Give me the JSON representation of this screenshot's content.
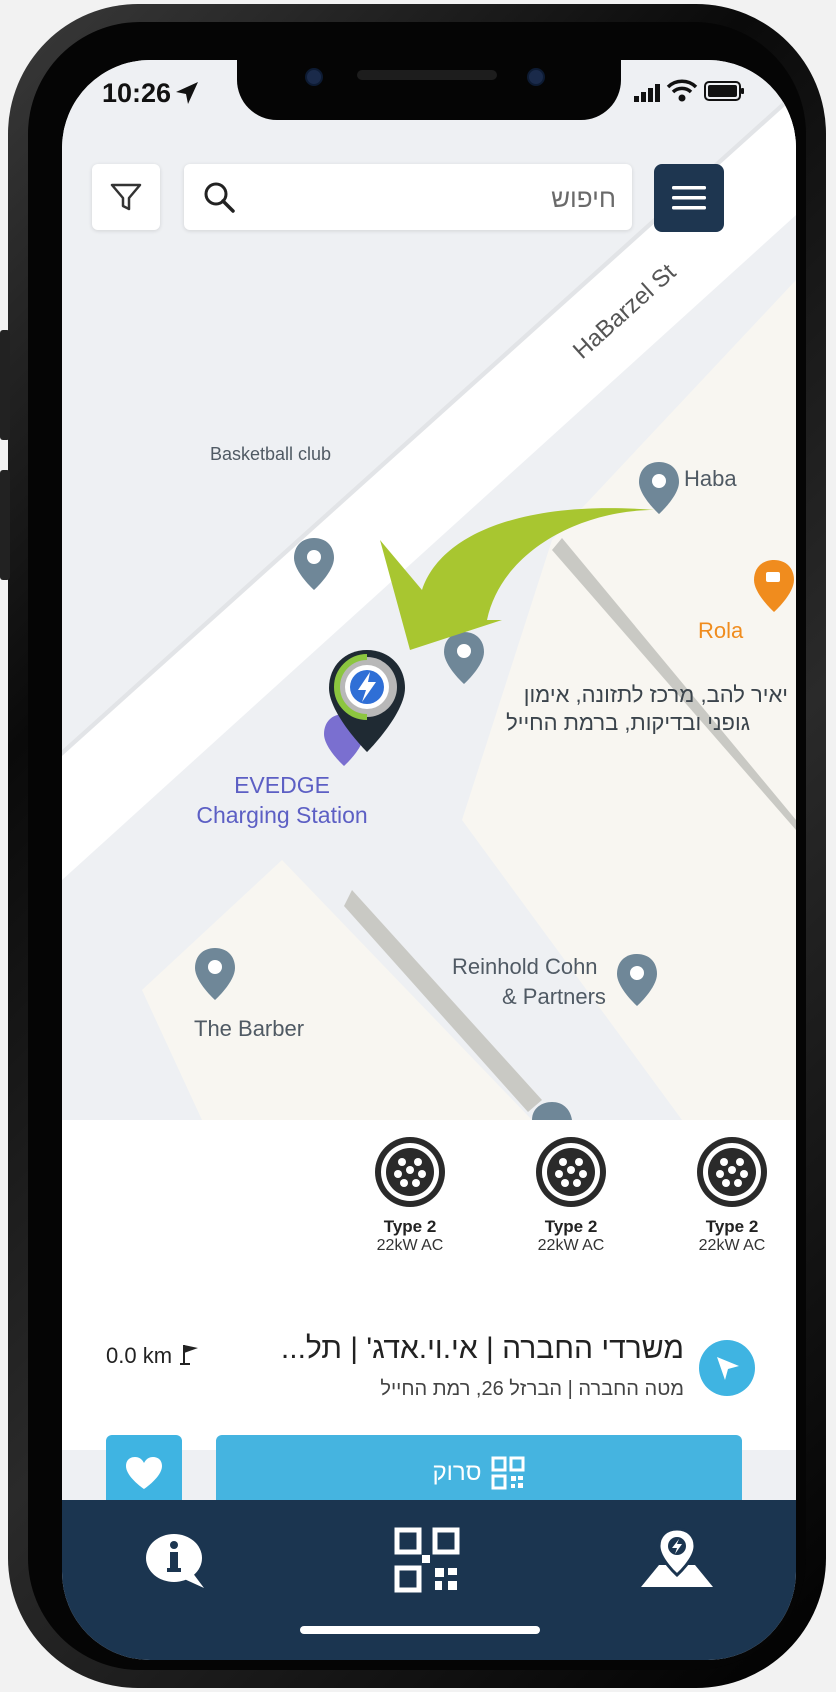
{
  "status_bar": {
    "time": "10:26"
  },
  "search": {
    "placeholder": "חיפוש"
  },
  "map": {
    "street": "HaBarzel St",
    "pois": {
      "basketball": "Basketball club",
      "haba": "Haba",
      "rola": "Rola",
      "yair_line1": "יאיר להב, מרכז לתזונה, אימון",
      "yair_line2": "גופני ובדיקות, ברמת החייל",
      "evedge_line1": "EVEDGE",
      "evedge_line2": "Charging Station",
      "reinhold_line1": "Reinhold Cohn",
      "reinhold_line2": "& Partners",
      "barber": "The Barber"
    }
  },
  "connectors": [
    {
      "type": "Type 2",
      "power": "22kW AC"
    },
    {
      "type": "Type 2",
      "power": "22kW AC"
    },
    {
      "type": "Type 2",
      "power": "22kW AC"
    }
  ],
  "station": {
    "name": "משרדי החברה | אי.וי.אדג' | תל...",
    "address": "מטה החברה | הברזל 26, רמת החייל",
    "distance": "0.0 km"
  },
  "actions": {
    "scan_label": "סרוק"
  },
  "colors": {
    "accent": "#3fb4e2",
    "navy": "#1b3550",
    "arrow": "#a8c630"
  },
  "tabs": [
    "info-icon",
    "qr-scan-icon",
    "map-location-icon"
  ]
}
